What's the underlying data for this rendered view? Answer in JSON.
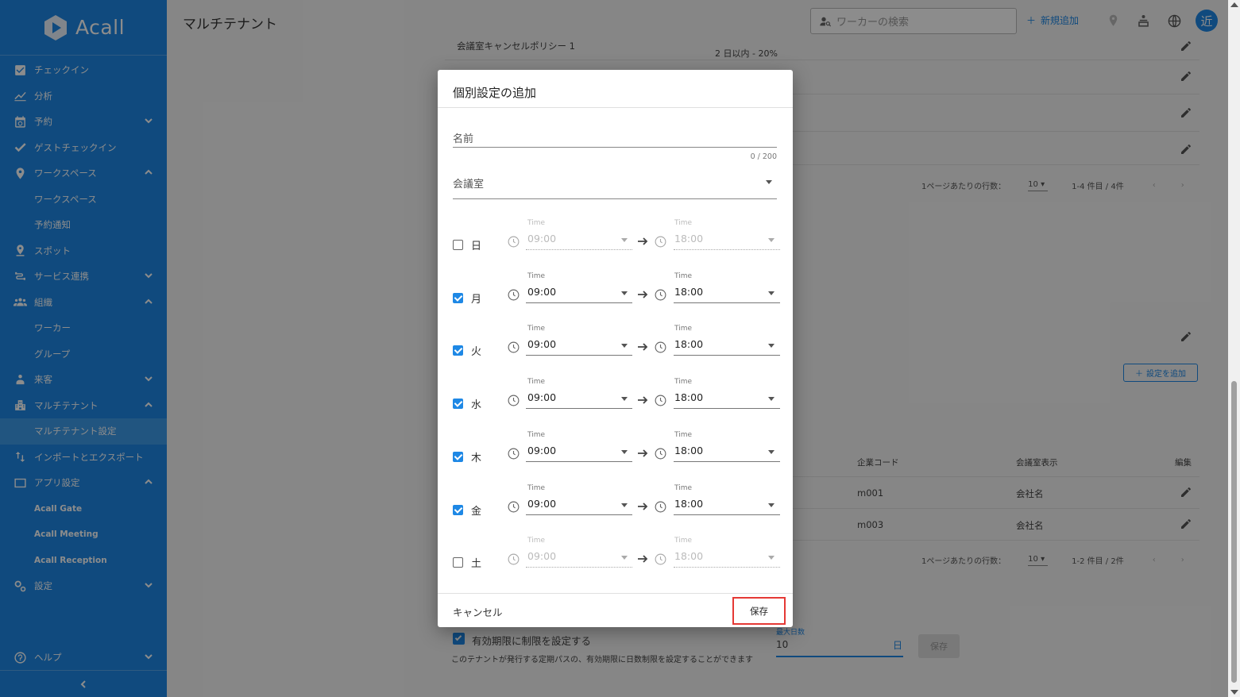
{
  "app": {
    "logo_text": "Acall",
    "page_title": "マルチテナント"
  },
  "sidebar": {
    "items": [
      {
        "label": "チェックイン",
        "icon": "checkbox-icon"
      },
      {
        "label": "分析",
        "icon": "chart-icon"
      },
      {
        "label": "予約",
        "icon": "calendar-icon"
      },
      {
        "label": "ゲストチェックイン",
        "icon": "check-icon"
      },
      {
        "label": "ワークスペース",
        "icon": "pin-icon"
      },
      {
        "label": "ワークスペース"
      },
      {
        "label": "予約通知"
      },
      {
        "label": "スポット",
        "icon": "spot-icon"
      },
      {
        "label": "サービス連携",
        "icon": "integration-icon"
      },
      {
        "label": "組織",
        "icon": "people-icon"
      },
      {
        "label": "ワーカー"
      },
      {
        "label": "グループ"
      },
      {
        "label": "来客",
        "icon": "visitor-icon"
      },
      {
        "label": "マルチテナント",
        "icon": "building-icon"
      },
      {
        "label": "マルチテナント設定"
      },
      {
        "label": "インポートとエクスポート",
        "icon": "import-export-icon"
      },
      {
        "label": "アプリ設定",
        "icon": "app-icon"
      },
      {
        "label": "Acall Gate"
      },
      {
        "label": "Acall Meeting"
      },
      {
        "label": "Acall Reception"
      },
      {
        "label": "設定",
        "icon": "gear-icon"
      }
    ],
    "help": "ヘルプ"
  },
  "header": {
    "search_placeholder": "ワーカーの検索",
    "new_add": "新規追加"
  },
  "background": {
    "policy_name": "会議室キャンセルポリシー 1",
    "policy_rule_1": "2 日以内 - 20%",
    "rows_per_page_label": "1ページあたりの行数：",
    "rows_per_page_value": "10",
    "range_1": "1-4 件目 / 4件",
    "range_2": "1-2 件目 / 2件",
    "add_setting": "設定を追加",
    "col_company_code": "企業コード",
    "col_room_display": "会議室表示",
    "col_edit": "編集",
    "row1_code": "m001",
    "row1_display": "会社名",
    "row2_code": "m003",
    "row2_display": "会社名",
    "expiry_checkbox_label": "有効期限に制限を設定する",
    "expiry_help": "このテナントが発行する定期パスの、有効期限に日数制限を設定することができます",
    "max_days_label": "最大日数",
    "max_days_value": "10",
    "max_days_unit": "日",
    "save": "保存"
  },
  "dialog": {
    "title": "個別設定の追加",
    "name_label": "名前",
    "name_counter": "0 / 200",
    "room_select_label": "会議室",
    "time_label": "Time",
    "days": [
      {
        "day": "日",
        "checked": false,
        "start": "09:00",
        "end": "18:00"
      },
      {
        "day": "月",
        "checked": true,
        "start": "09:00",
        "end": "18:00"
      },
      {
        "day": "火",
        "checked": true,
        "start": "09:00",
        "end": "18:00"
      },
      {
        "day": "水",
        "checked": true,
        "start": "09:00",
        "end": "18:00"
      },
      {
        "day": "木",
        "checked": true,
        "start": "09:00",
        "end": "18:00"
      },
      {
        "day": "金",
        "checked": true,
        "start": "09:00",
        "end": "18:00"
      },
      {
        "day": "土",
        "checked": false,
        "start": "09:00",
        "end": "18:00"
      }
    ],
    "cancel": "キャンセル",
    "save": "保存"
  },
  "colors": {
    "brand": "#1e88e5",
    "highlight": "#e53935"
  },
  "avatar_text": "近"
}
